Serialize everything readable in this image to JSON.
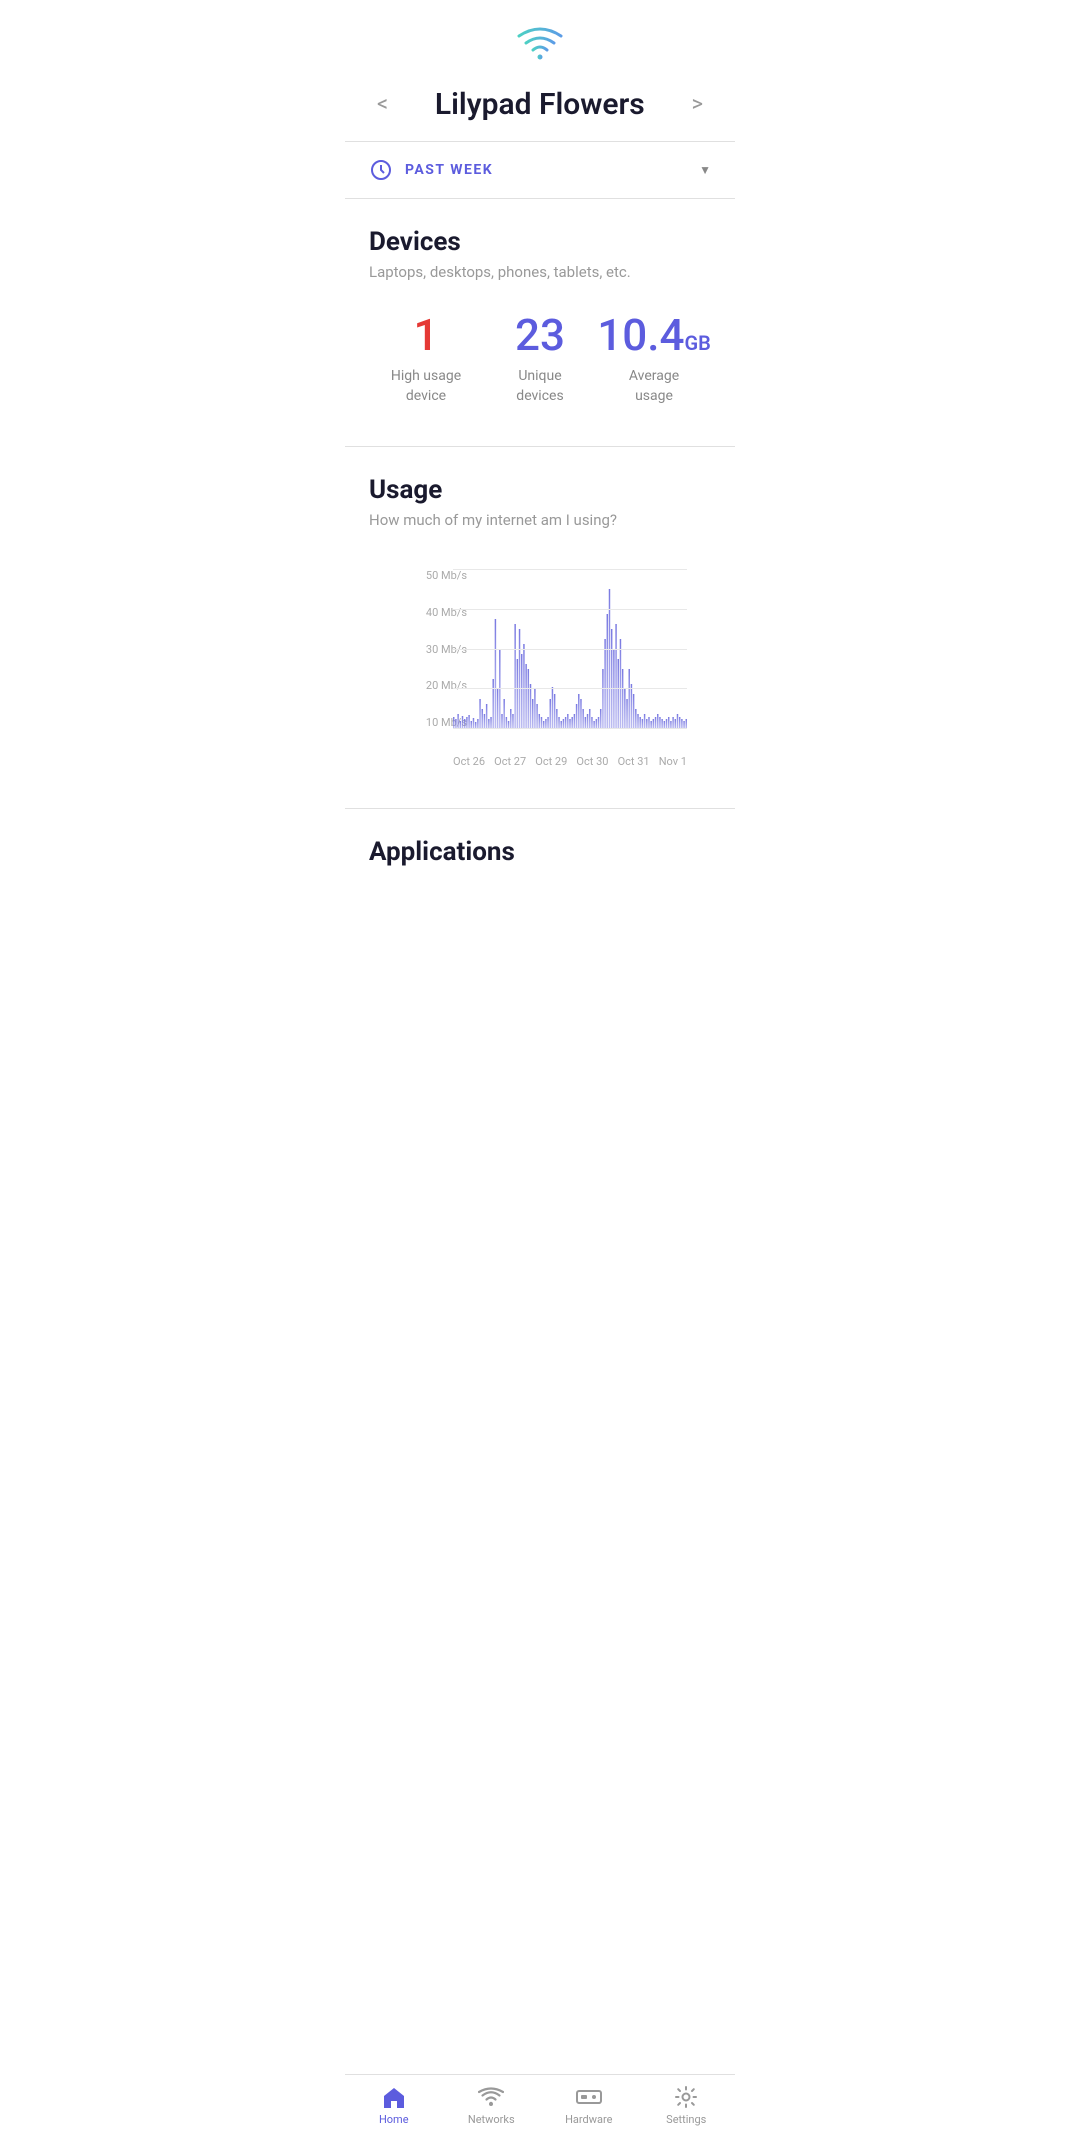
{
  "header": {
    "title": "Lilypad Flowers",
    "prev_arrow": "<",
    "next_arrow": ">"
  },
  "period": {
    "label": "PAST WEEK",
    "icon": "clock-icon"
  },
  "devices": {
    "section_title": "Devices",
    "section_subtitle": "Laptops, desktops, phones, tablets, etc.",
    "stats": [
      {
        "value": "1",
        "label": "High usage\ndevice",
        "color": "red"
      },
      {
        "value": "23",
        "label": "Unique\ndevices",
        "color": "purple"
      },
      {
        "value": "10.4",
        "unit": "GB",
        "label": "Average\nusage",
        "color": "purple"
      }
    ]
  },
  "usage": {
    "section_title": "Usage",
    "section_subtitle": "How much of my internet am I using?",
    "y_labels": [
      "50 Mb/s",
      "40 Mb/s",
      "30 Mb/s",
      "20 Mb/s",
      "10 Mb/s"
    ],
    "x_labels": [
      "Oct 26",
      "Oct 27",
      "Oct 29",
      "Oct 30",
      "Oct 31",
      "Nov 1"
    ]
  },
  "applications": {
    "section_title": "Applications"
  },
  "bottom_nav": {
    "items": [
      {
        "id": "home",
        "label": "Home",
        "active": true
      },
      {
        "id": "networks",
        "label": "Networks",
        "active": false
      },
      {
        "id": "hardware",
        "label": "Hardware",
        "active": false
      },
      {
        "id": "settings",
        "label": "Settings",
        "active": false
      }
    ]
  }
}
